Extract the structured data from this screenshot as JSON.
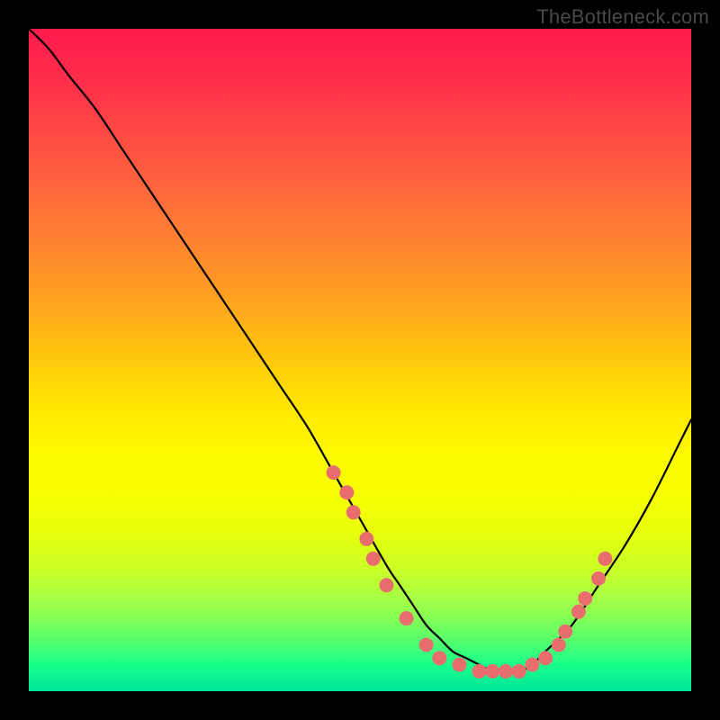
{
  "attribution": "TheBottleneck.com",
  "chart_data": {
    "type": "line",
    "title": "",
    "xlabel": "",
    "ylabel": "",
    "xlim": [
      0,
      100
    ],
    "ylim": [
      0,
      100
    ],
    "grid": false,
    "legend": false,
    "series": [
      {
        "name": "bottleneck-curve",
        "x": [
          0,
          3,
          6,
          10,
          14,
          18,
          22,
          26,
          30,
          34,
          38,
          42,
          46,
          50,
          54,
          56,
          58,
          60,
          62,
          64,
          66,
          68,
          70,
          72,
          74,
          76,
          78,
          82,
          86,
          90,
          94,
          98,
          100
        ],
        "y": [
          100,
          97,
          93,
          88,
          82,
          76,
          70,
          64,
          58,
          52,
          46,
          40,
          33,
          26,
          19,
          16,
          13,
          10,
          8,
          6,
          5,
          4,
          3,
          3,
          3,
          4,
          6,
          10,
          16,
          22,
          29,
          37,
          41
        ]
      }
    ],
    "markers": {
      "name": "highlight-dots",
      "color": "#e86e6e",
      "radius_px": 8,
      "points": [
        {
          "x": 46,
          "y": 33
        },
        {
          "x": 48,
          "y": 30
        },
        {
          "x": 49,
          "y": 27
        },
        {
          "x": 51,
          "y": 23
        },
        {
          "x": 52,
          "y": 20
        },
        {
          "x": 54,
          "y": 16
        },
        {
          "x": 57,
          "y": 11
        },
        {
          "x": 60,
          "y": 7
        },
        {
          "x": 62,
          "y": 5
        },
        {
          "x": 65,
          "y": 4
        },
        {
          "x": 68,
          "y": 3
        },
        {
          "x": 70,
          "y": 3
        },
        {
          "x": 72,
          "y": 3
        },
        {
          "x": 74,
          "y": 3
        },
        {
          "x": 76,
          "y": 4
        },
        {
          "x": 78,
          "y": 5
        },
        {
          "x": 80,
          "y": 7
        },
        {
          "x": 81,
          "y": 9
        },
        {
          "x": 83,
          "y": 12
        },
        {
          "x": 84,
          "y": 14
        },
        {
          "x": 86,
          "y": 17
        },
        {
          "x": 87,
          "y": 20
        }
      ]
    }
  },
  "colors": {
    "background": "#000000",
    "gradient_top": "#ff1a4d",
    "gradient_bottom": "#00e59a",
    "curve": "#000000",
    "marker": "#e86e6e",
    "attribution": "#4a4a4a"
  }
}
